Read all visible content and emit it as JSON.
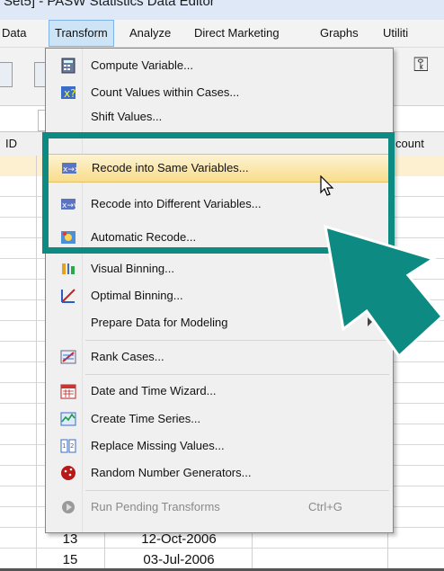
{
  "window": {
    "title": "Set5] - PASW Statistics Data Editor"
  },
  "menubar": {
    "items": [
      {
        "label": "Data"
      },
      {
        "label": "Transform"
      },
      {
        "label": "Analyze"
      },
      {
        "label": "Direct Marketing"
      },
      {
        "label": "Graphs"
      },
      {
        "label": "Utiliti"
      }
    ],
    "active": "Transform"
  },
  "grid": {
    "header_id": "ID",
    "header_count": "count",
    "rows": [
      {
        "num": "13",
        "date": "12-Oct-2006"
      },
      {
        "num": "15",
        "date": "03-Jul-2006"
      }
    ]
  },
  "transform_menu": {
    "items": [
      {
        "label": "Compute Variable...",
        "icon": "calculator-icon"
      },
      {
        "label": "Count Values within Cases...",
        "icon": "count-values-icon"
      },
      {
        "label": "Shift Values...",
        "icon": ""
      },
      {
        "label": "Recode into Same Variables...",
        "icon": "recode-same-icon"
      },
      {
        "label": "Recode into Different Variables...",
        "icon": "recode-different-icon"
      },
      {
        "label": "Automatic Recode...",
        "icon": "automatic-recode-icon"
      },
      {
        "label": "Visual Binning...",
        "icon": "visual-binning-icon"
      },
      {
        "label": "Optimal Binning...",
        "icon": "optimal-binning-icon"
      },
      {
        "label": "Prepare Data for Modeling",
        "icon": ""
      },
      {
        "label": "Rank Cases...",
        "icon": "rank-cases-icon"
      },
      {
        "label": "Date and Time Wizard...",
        "icon": "calendar-icon"
      },
      {
        "label": "Create Time Series...",
        "icon": "time-series-icon"
      },
      {
        "label": "Replace Missing Values...",
        "icon": "replace-missing-icon"
      },
      {
        "label": "Random Number Generators...",
        "icon": "dice-icon"
      },
      {
        "label": "Run Pending Transforms",
        "icon": "run-pending-icon",
        "shortcut": "Ctrl+G"
      }
    ],
    "hovered": "Recode into Same Variables..."
  },
  "colors": {
    "highlight_box": "#0d8a82",
    "arrow": "#0d8a82",
    "hover_bg": "#f9dd8c"
  }
}
